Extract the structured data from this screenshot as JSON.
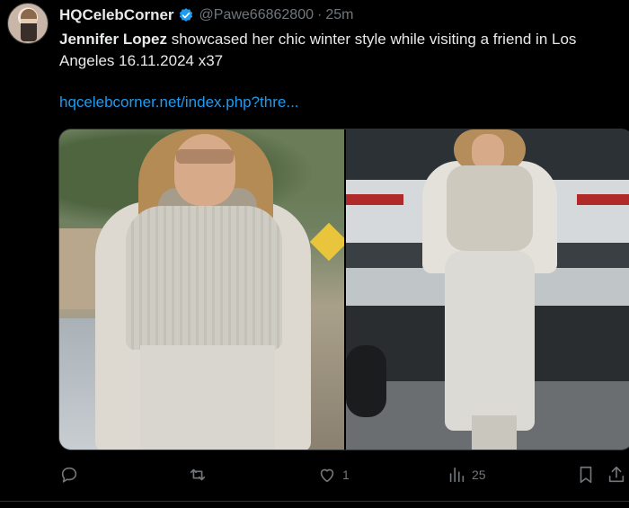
{
  "author": {
    "display_name": "HQCelebCorner",
    "handle": "@Pawe66862800",
    "separator": "·",
    "time": "25m"
  },
  "tweet": {
    "text_bold": "Jennifer Lopez",
    "text_line1_rest": " showcased her chic winter style while visiting a friend in Los",
    "text_line2": "Angeles 16.11.2024 x37",
    "link": "hqcelebcorner.net/index.php?thre..."
  },
  "actions": {
    "reply": {
      "icon": "reply-icon",
      "count": ""
    },
    "retweet": {
      "icon": "retweet-icon",
      "count": ""
    },
    "like": {
      "icon": "heart-icon",
      "count": "1"
    },
    "views": {
      "icon": "views-icon",
      "count": "25"
    },
    "bookmark": {
      "icon": "bookmark-icon"
    },
    "share": {
      "icon": "share-icon"
    }
  },
  "colors": {
    "background": "#000000",
    "text": "#e7e9ea",
    "muted": "#71767b",
    "link": "#1d9bf0",
    "verified": "#1d9bf0"
  }
}
